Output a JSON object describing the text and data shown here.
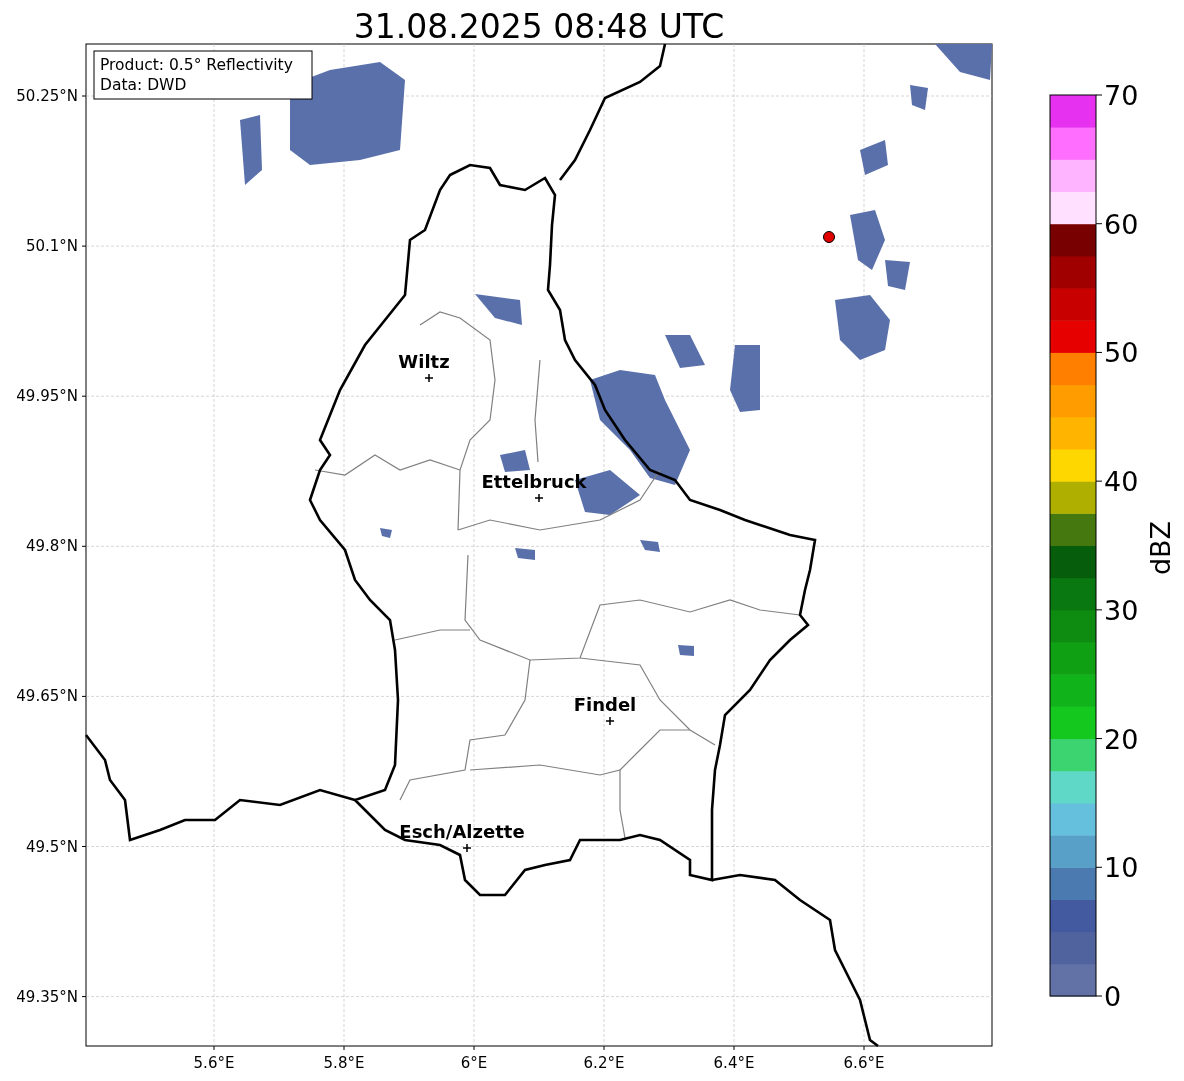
{
  "title": "31.08.2025 08:48 UTC",
  "info_box": [
    "Product: 0.5° Reflectivity",
    "Data: DWD"
  ],
  "map": {
    "x_ticks": [
      "5.6°E",
      "5.8°E",
      "6°E",
      "6.2°E",
      "6.4°E",
      "6.6°E"
    ],
    "y_ticks": [
      "50.25°N",
      "50.1°N",
      "49.95°N",
      "49.8°N",
      "49.65°N",
      "49.5°N",
      "49.35°N"
    ],
    "cities": [
      {
        "name": "Wiltz"
      },
      {
        "name": "Ettelbruck"
      },
      {
        "name": "Findel"
      },
      {
        "name": "Esch/Alzette"
      }
    ]
  },
  "colorbar": {
    "label": "dBZ",
    "ticks": [
      "70",
      "60",
      "50",
      "40",
      "30",
      "20",
      "10",
      "0"
    ],
    "bands": [
      {
        "color": "#6272a6"
      },
      {
        "color": "#51639e"
      },
      {
        "color": "#435aa0"
      },
      {
        "color": "#4a7ab0"
      },
      {
        "color": "#58a0c8"
      },
      {
        "color": "#64c0dc"
      },
      {
        "color": "#60d8c8"
      },
      {
        "color": "#3cd470"
      },
      {
        "color": "#14c81e"
      },
      {
        "color": "#10b41a"
      },
      {
        "color": "#10a014"
      },
      {
        "color": "#0e8c12"
      },
      {
        "color": "#0a7810"
      },
      {
        "color": "#065e0c"
      },
      {
        "color": "#467810"
      },
      {
        "color": "#afaf00"
      },
      {
        "color": "#ffd700"
      },
      {
        "color": "#ffb400"
      },
      {
        "color": "#ff9c00"
      },
      {
        "color": "#ff8000"
      },
      {
        "color": "#e60000"
      },
      {
        "color": "#c80000"
      },
      {
        "color": "#a00000"
      },
      {
        "color": "#780000"
      },
      {
        "color": "#ffe0ff"
      },
      {
        "color": "#ffb4ff"
      },
      {
        "color": "#ff6eff"
      },
      {
        "color": "#e632f0"
      }
    ]
  }
}
